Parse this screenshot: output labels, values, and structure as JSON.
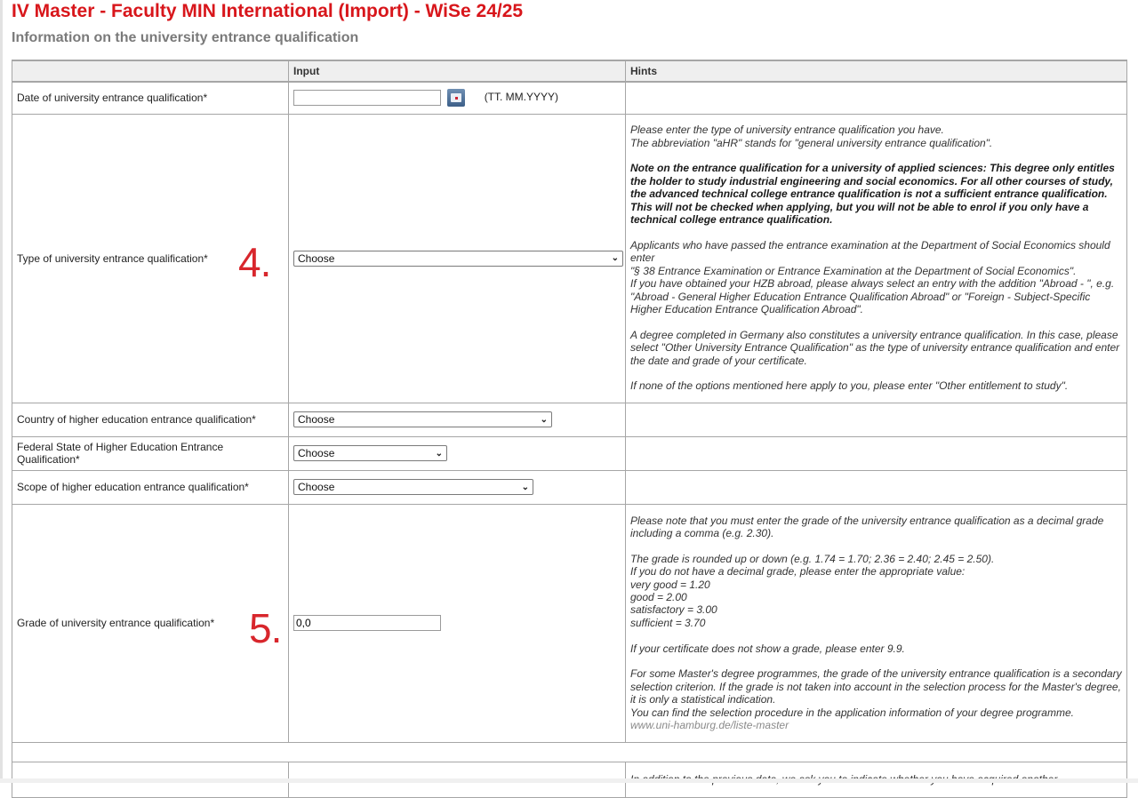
{
  "page": {
    "title": "IV Master - Faculty MIN International (Import) - WiSe 24/25",
    "section_title": "Information on the university entrance qualification"
  },
  "table": {
    "headers": [
      "",
      "Input",
      "Hints"
    ],
    "rows": {
      "date": {
        "label": "Date of university entrance qualification*",
        "value": "",
        "format_hint": "(TT. MM.YYYY)"
      },
      "type": {
        "label": "Type of university entrance qualification*",
        "selected": "Choose",
        "annotation": "4.",
        "hints": {
          "p1_line1": "Please enter the type of university entrance qualification you have.",
          "p1_line2": "The abbreviation \"aHR\" stands for \"general university entrance qualification\".",
          "p2_bold": "Note on the entrance qualification for a university of applied sciences: This degree only entitles the holder to study industrial engineering and social economics. For all other courses of study, the advanced technical college entrance qualification is not a sufficient entrance qualification. This will not be checked when applying, but you will not be able to enrol if you only have a technical college entrance qualification.",
          "p3_line1": "Applicants who have passed the entrance examination at the Department of Social Economics should enter",
          "p3_line2": "\"§ 38 Entrance Examination or Entrance Examination at the Department of Social Economics\".",
          "p3_line3": "If you have obtained your HZB abroad, please always select an entry with the addition \"Abroad - \", e.g. \"Abroad - General Higher Education Entrance Qualification Abroad\" or \"Foreign - Subject-Specific Higher Education Entrance Qualification Abroad\".",
          "p4": "A degree completed in Germany also constitutes a university entrance qualification. In this case, please select \"Other University Entrance Qualification\" as the type of university entrance qualification and enter the date and grade of your certificate.",
          "p5": "If none of the options mentioned here apply to you, please enter \"Other entitlement to study\"."
        }
      },
      "country": {
        "label": "Country of higher education entrance qualification*",
        "selected": "Choose"
      },
      "federal_state": {
        "label": "Federal State of Higher Education Entrance Qualification*",
        "selected": "Choose"
      },
      "scope": {
        "label": "Scope of higher education entrance qualification*",
        "selected": "Choose"
      },
      "grade": {
        "label": "Grade of university entrance qualification*",
        "value": "0,0",
        "annotation": "5.",
        "hints": {
          "p1": "Please note that you must enter the grade of the university entrance qualification as a decimal grade including a comma (e.g. 2.30).",
          "p2_line1": "The grade is rounded up or down (e.g. 1.74 = 1.70; 2.36 = 2.40; 2.45 = 2.50).",
          "p2_line2": "If you do not have a decimal grade, please enter the appropriate value:",
          "grades": [
            "very good = 1.20",
            "good = 2.00",
            "satisfactory = 3.00",
            "sufficient = 3.70"
          ],
          "p3": "If your certificate does not show a grade, please enter 9.9.",
          "p4_line1": "For some Master's degree programmes, the grade of the university entrance qualification is a secondary selection criterion. If the grade is not taken into account in the selection process for the Master's degree, it is only a statistical indication.",
          "p4_line2": "You can find the selection procedure in the application information of your degree programme.",
          "link": "www.uni-hamburg.de/liste-master"
        }
      },
      "next": {
        "hint_partial": "In addition to the previous data, we ask you to indicate whether you have acquired another"
      }
    }
  },
  "colors": {
    "title": "#d8161b",
    "section_title": "#7a7a7a",
    "annotation": "#d8262c",
    "header_bg": "#efefef",
    "border": "#a6a6a6"
  }
}
